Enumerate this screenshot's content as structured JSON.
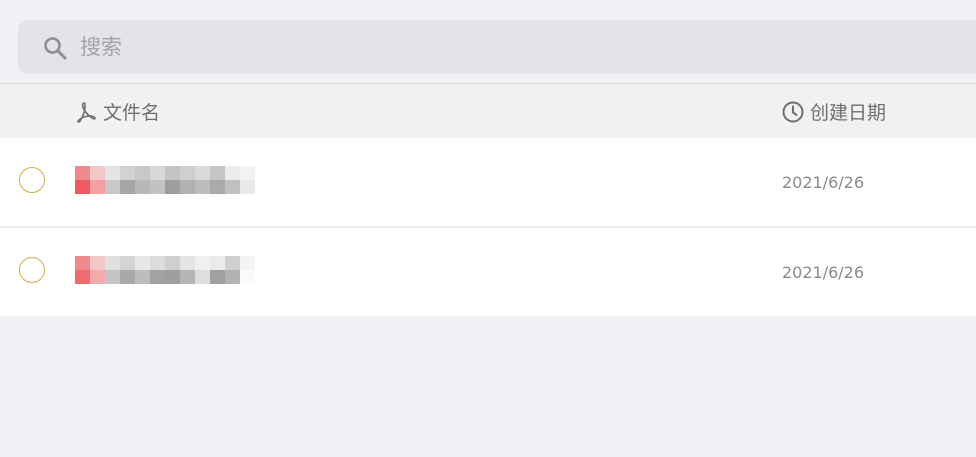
{
  "search": {
    "placeholder": "搜索",
    "icon": "search-icon"
  },
  "header": {
    "name_label": "文件名",
    "name_icon": "pdf-icon",
    "date_label": "创建日期",
    "date_icon": "clock-icon"
  },
  "files": [
    {
      "date": "2021/6/26",
      "selected": false
    },
    {
      "date": "2021/6/26",
      "selected": false
    }
  ],
  "colors": {
    "background": "#f1f0f5",
    "radio_accent": "#d5ac4a",
    "text_muted": "#8a8a8a"
  }
}
